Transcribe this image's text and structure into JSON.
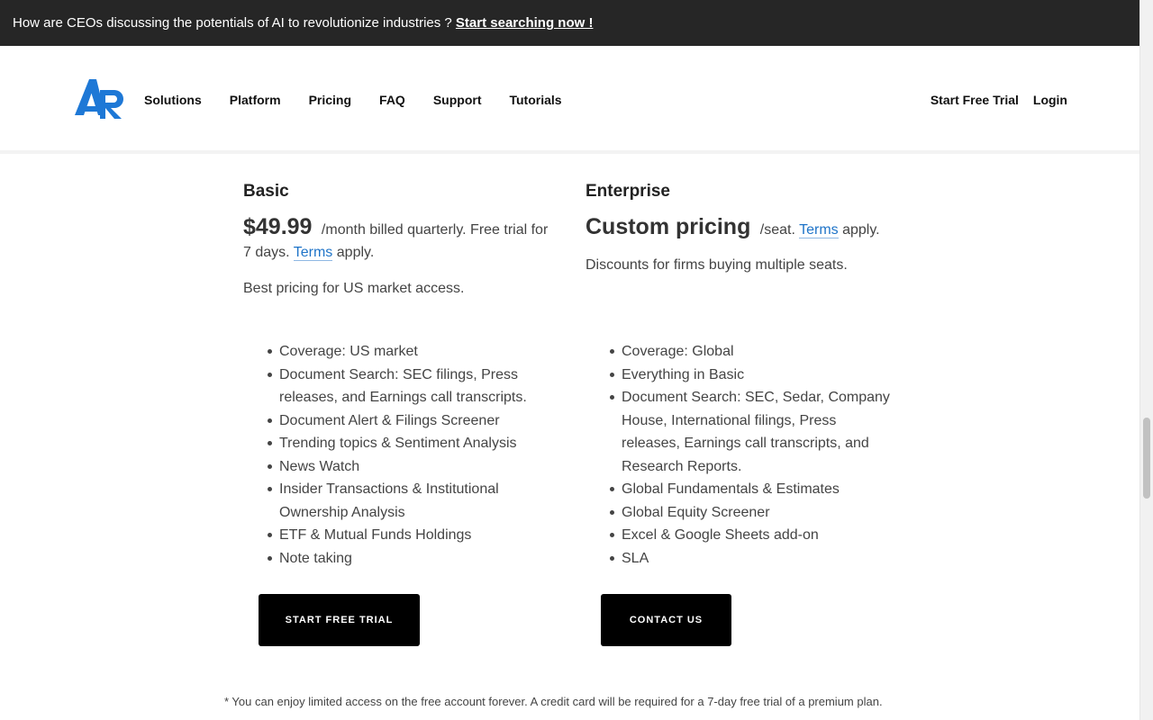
{
  "announcement": {
    "text": "How are CEOs discussing the potentials of AI to revolutionize industries ? ",
    "link": "Start searching now !"
  },
  "header": {
    "nav": [
      "Solutions",
      "Platform",
      "Pricing",
      "FAQ",
      "Support",
      "Tutorials"
    ],
    "start_trial": "Start Free Trial",
    "login": "Login"
  },
  "plans": {
    "basic": {
      "name": "Basic",
      "price": "$49.99",
      "price_note": "/month billed quarterly. Free trial for 7 days.",
      "terms": "Terms",
      "apply": "apply.",
      "description": "Best pricing for US market access.",
      "features": [
        "Coverage: US market",
        "Document Search: SEC filings, Press releases, and Earnings call transcripts.",
        "Document Alert & Filings Screener",
        "Trending topics & Sentiment Analysis",
        "News Watch",
        "Insider Transactions & Institutional Ownership Analysis",
        "ETF & Mutual Funds Holdings",
        "Note taking"
      ],
      "cta": "START FREE TRIAL"
    },
    "enterprise": {
      "name": "Enterprise",
      "price": "Custom pricing",
      "price_note": "/seat.",
      "terms": "Terms",
      "apply": "apply.",
      "description": "Discounts for firms buying multiple seats.",
      "features": [
        "Coverage: Global",
        "Everything in Basic",
        "Document Search: SEC, Sedar, Company House, International filings, Press releases, Earnings call transcripts, and Research Reports.",
        "Global Fundamentals & Estimates",
        "Global Equity Screener",
        "Excel & Google Sheets add-on",
        "SLA"
      ],
      "cta": "CONTACT US"
    }
  },
  "footnote": "* You can enjoy limited access on the free account forever. A credit card will be required for a 7-day free trial of a premium plan.",
  "colors": {
    "announcement_bg": "#262626",
    "link_blue": "#1f74c8",
    "logo_blue": "#1e78d6",
    "button_bg": "#000000"
  }
}
